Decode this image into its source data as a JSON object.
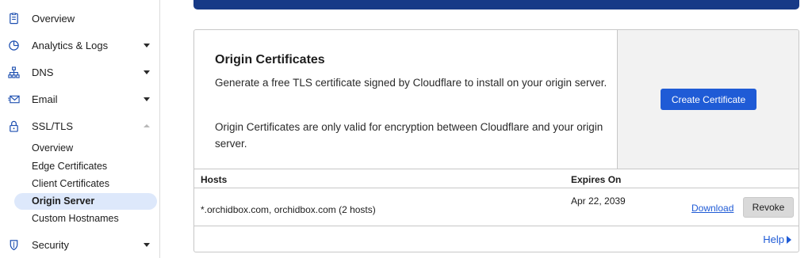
{
  "sidebar": {
    "items": [
      {
        "label": "Overview",
        "icon": "document-icon",
        "has_caret": false
      },
      {
        "label": "Analytics & Logs",
        "icon": "pie-chart-icon",
        "has_caret": true
      },
      {
        "label": "DNS",
        "icon": "network-icon",
        "has_caret": true
      },
      {
        "label": "Email",
        "icon": "email-icon",
        "has_caret": true
      },
      {
        "label": "SSL/TLS",
        "icon": "lock-icon",
        "has_caret": true,
        "expanded": true
      },
      {
        "label": "Security",
        "icon": "shield-icon",
        "has_caret": true
      }
    ],
    "ssl_subitems": [
      "Overview",
      "Edge Certificates",
      "Client Certificates",
      "Origin Server",
      "Custom Hostnames"
    ],
    "active_subitem": "Origin Server"
  },
  "card": {
    "title": "Origin Certificates",
    "description": "Generate a free TLS certificate signed by Cloudflare to install on your origin server.",
    "description2": "Origin Certificates are only valid for encryption between Cloudflare and your origin server.",
    "create_button": "Create Certificate"
  },
  "table": {
    "headers": {
      "hosts": "Hosts",
      "expires": "Expires On"
    },
    "rows": [
      {
        "hosts": "*.orchidbox.com, orchidbox.com (2 hosts)",
        "expires": "Apr 22, 2039",
        "download": "Download",
        "revoke": "Revoke"
      }
    ]
  },
  "footer": {
    "help": "Help"
  },
  "colors": {
    "accent": "#1f5bd6",
    "banner": "#173a87",
    "active_bg": "#dde8fb"
  }
}
